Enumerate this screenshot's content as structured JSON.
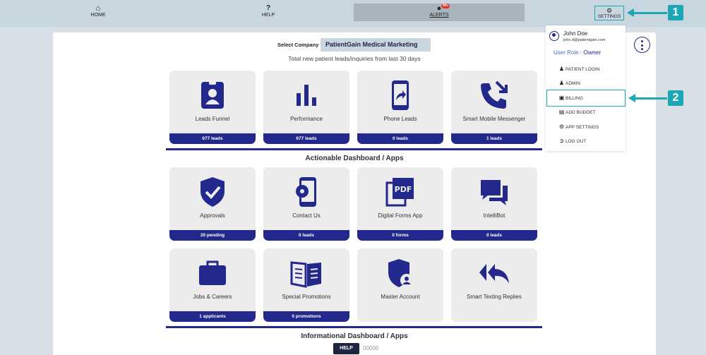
{
  "nav": {
    "home_label": "HOME",
    "help_label": "HELP",
    "alerts_label": "ALERTS",
    "alerts_badge": "99+",
    "settings_label": "SETTINGS",
    "home_icon": "home-icon",
    "help_icon": "question-icon",
    "alerts_icon": "bell-icon",
    "settings_icon": "gear-icon"
  },
  "callouts": {
    "one": "1",
    "two": "2",
    "color": "#1ba7b4"
  },
  "company": {
    "label": "Select Company",
    "selected": "PatientGain Medical Marketing"
  },
  "subtitle": "Total new patient leads/inquiries from last 30 days",
  "top_cards": [
    {
      "label": "Leads Funnel",
      "count": "677 leads",
      "icon": "id-badge-icon"
    },
    {
      "label": "Performance",
      "count": "677 leads",
      "icon": "bar-chart-icon"
    },
    {
      "label": "Phone Leads",
      "count": "0 leads",
      "icon": "mobile-share-icon"
    },
    {
      "label": "Smart Mobile Messenger",
      "count": "1 leads",
      "icon": "phone-forward-icon"
    }
  ],
  "sections": {
    "actionable": "Actionable Dashboard / Apps",
    "informational": "Informational Dashboard / Apps"
  },
  "app_cards": [
    {
      "label": "Approvals",
      "count": "20 pending",
      "icon": "shield-check-icon"
    },
    {
      "label": "Contact Us",
      "count": "0 leads",
      "icon": "mobile-gear-icon"
    },
    {
      "label": "Digital Forms App",
      "count": "0 forms",
      "icon": "pdf-icon"
    },
    {
      "label": "IntelliBot",
      "count": "0 leads",
      "icon": "chat-bubbles-icon"
    },
    {
      "label": "Jobs & Careers",
      "count": "1 applicants",
      "icon": "briefcase-icon"
    },
    {
      "label": "Special Promotions",
      "count": "0 promotions",
      "icon": "open-book-icon"
    },
    {
      "label": "Master Account",
      "count": "",
      "icon": "shield-user-icon"
    },
    {
      "label": "Smart Texting Replies",
      "count": "",
      "icon": "reply-all-icon"
    }
  ],
  "user": {
    "name": "John Doe",
    "email": "john.d@patientgain.com",
    "role_label": "User Role : ",
    "role_value": "Owner"
  },
  "menu": [
    {
      "label": "PATIENT LOGIN",
      "icon": "user-icon"
    },
    {
      "label": "ADMIN",
      "icon": "user-icon"
    },
    {
      "label": "BILLING",
      "icon": "money-bill-icon"
    },
    {
      "label": "ADD BUDGET",
      "icon": "credit-card-icon"
    },
    {
      "label": "APP SETTINGS",
      "icon": "gear-icon"
    },
    {
      "label": "LOG OUT",
      "icon": "sign-out-icon"
    }
  ],
  "footer": {
    "help_label": "HELP",
    "code": "00000"
  },
  "colors": {
    "navy": "#23298c",
    "teal": "#1ba7b4",
    "topbar": "#c8d6e0",
    "badge": "#e3342f"
  }
}
